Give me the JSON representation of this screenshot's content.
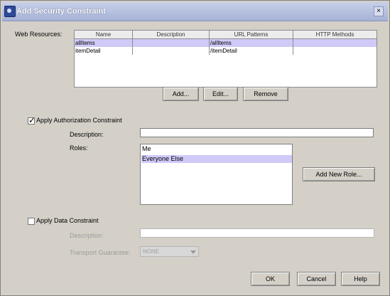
{
  "window": {
    "title": "Add Security Constraint",
    "close_symbol": "×"
  },
  "web_resources": {
    "label": "Web Resources:",
    "columns": [
      "Name",
      "Description",
      "URL Patterns",
      "HTTP Methods"
    ],
    "rows": [
      [
        "allItems",
        "",
        "/allItems",
        ""
      ],
      [
        "itemDetail",
        "",
        "/itemDetail",
        ""
      ]
    ],
    "buttons": {
      "add": "Add...",
      "edit": "Edit...",
      "remove": "Remove"
    }
  },
  "authorization": {
    "checkbox_label": "Apply Authorization Constraint",
    "checked": true,
    "description_label": "Description:",
    "description_value": "",
    "roles_label": "Roles:",
    "roles": [
      "Me",
      "Everyone Else"
    ],
    "selected_role": "Everyone Else",
    "add_role_button": "Add New Role..."
  },
  "data_constraint": {
    "checkbox_label": "Apply Data Constraint",
    "checked": false,
    "description_label": "Description:",
    "description_value": "",
    "transport_label": "Transport Guarantee:",
    "transport_value": "NONE"
  },
  "dialog_buttons": {
    "ok": "OK",
    "cancel": "Cancel",
    "help": "Help"
  }
}
